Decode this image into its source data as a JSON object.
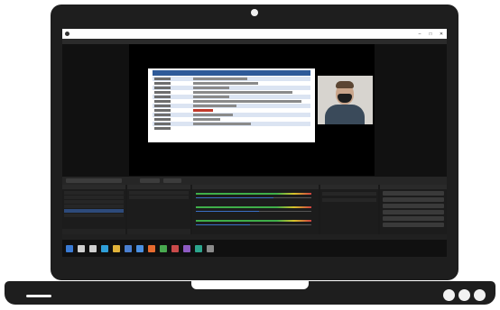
{
  "window": {
    "title": "",
    "controls": [
      "–",
      "□",
      "✕"
    ]
  },
  "taskbar": {
    "time": "",
    "icons": [
      {
        "name": "start-icon",
        "color": "#3a7bd5"
      },
      {
        "name": "search-icon",
        "color": "#cfcfcf"
      },
      {
        "name": "task-view-icon",
        "color": "#cfcfcf"
      },
      {
        "name": "edge-icon",
        "color": "#2f9fd8"
      },
      {
        "name": "file-explorer-icon",
        "color": "#e0b23a"
      },
      {
        "name": "mail-icon",
        "color": "#4a7fd0"
      },
      {
        "name": "store-icon",
        "color": "#4a90e2"
      },
      {
        "name": "firefox-icon",
        "color": "#e66b2f"
      },
      {
        "name": "chrome-icon",
        "color": "#48a94f"
      },
      {
        "name": "app-icon-a",
        "color": "#c94a4a"
      },
      {
        "name": "app-icon-b",
        "color": "#8e5bc2"
      },
      {
        "name": "app-icon-c",
        "color": "#2ca58d"
      },
      {
        "name": "obs-icon",
        "color": "#8b8b8b"
      }
    ]
  },
  "colors": {
    "slide_header": "#2e5a99",
    "slide_alt_row": "#dbe4f2",
    "selected_item": "#2d4a7a",
    "obs_panel": "#1c1c1c"
  }
}
